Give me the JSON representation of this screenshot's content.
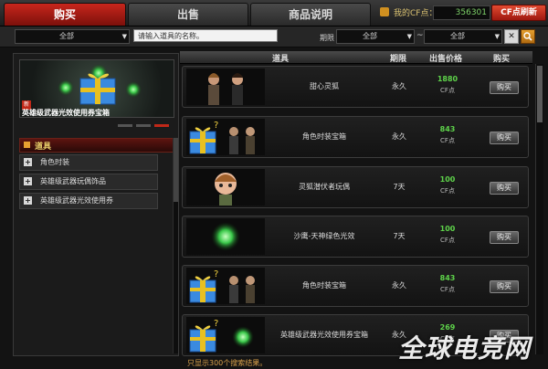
{
  "tabs": [
    "购买",
    "出售",
    "商品说明"
  ],
  "account": {
    "cf_label": "我的CF点：",
    "cf_value": "356301",
    "refresh_label": "CF点刷新"
  },
  "filter": {
    "category": "全部",
    "search_placeholder": "请输入道具的名称。",
    "period_label": "期限",
    "period_from": "全部",
    "tilde": "~",
    "period_to": "全部"
  },
  "featured": {
    "caption": "英雄级武器光效使用券宝箱",
    "tag": "新"
  },
  "sidebar": {
    "title": "道具",
    "items": [
      {
        "label": "角色时装"
      },
      {
        "label": "英雄级武器玩偶饰品"
      },
      {
        "label": "英雄级武器光效使用券"
      }
    ]
  },
  "table": {
    "headers": [
      "道具",
      "期限",
      "出售价格",
      "购买"
    ],
    "rows": [
      {
        "name": "甜心灵狐",
        "period": "永久",
        "price": "1880",
        "currency": "CF点",
        "buy": "购买",
        "thumb": "female-character-duo"
      },
      {
        "name": "角色时装宝箱",
        "period": "永久",
        "price": "843",
        "currency": "CF点",
        "buy": "购买",
        "thumb": "gift-box-with-characters"
      },
      {
        "name": "灵狐潜伏者玩偶",
        "period": "7天",
        "price": "100",
        "currency": "CF点",
        "buy": "购买",
        "thumb": "chibi-doll"
      },
      {
        "name": "沙鹰-天神绿色光效",
        "period": "7天",
        "price": "100",
        "currency": "CF点",
        "buy": "购买",
        "thumb": "green-glow-orb"
      },
      {
        "name": "角色时装宝箱",
        "period": "永久",
        "price": "843",
        "currency": "CF点",
        "buy": "购买",
        "thumb": "gift-box-with-characters"
      },
      {
        "name": "英雄级武器光效使用券宝箱",
        "period": "永久",
        "price": "269",
        "currency": "CF点",
        "buy": "购买",
        "thumb": "gift-box-with-green-glow"
      }
    ]
  },
  "result_text": "只显示300个搜索结果。",
  "watermark": "全球电竞网",
  "colors": {
    "accent": "#c8261c",
    "price": "#5ed34a",
    "gold": "#e8d06a"
  }
}
